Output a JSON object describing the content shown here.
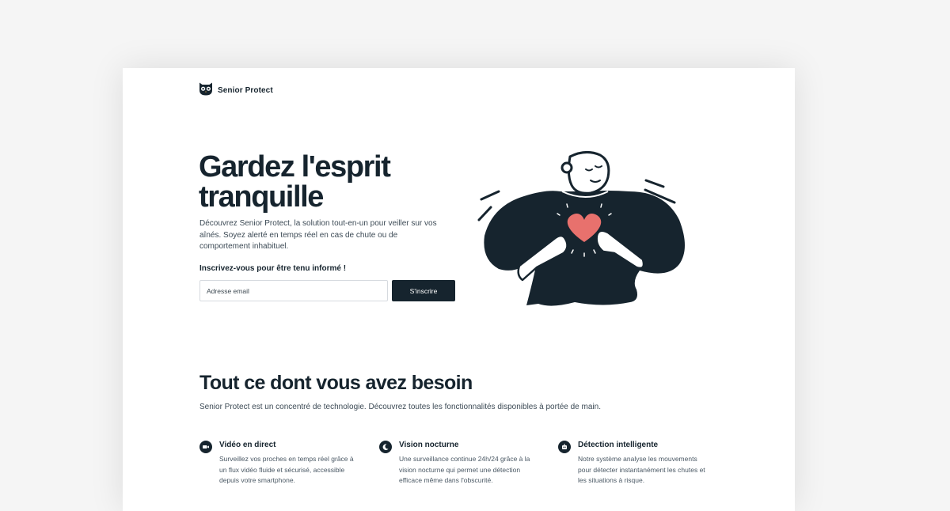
{
  "brand": {
    "name": "Senior Protect",
    "logo_icon": "owl-icon"
  },
  "hero": {
    "title": "Gardez l'esprit tranquille",
    "description": "Découvrez Senior Protect, la solution tout-en-un pour veiller sur vos aînés. Soyez alerté en temps réel en cas de chute ou de comportement inhabituel.",
    "signup_label": "Inscrivez-vous pour être tenu informé !",
    "email_placeholder": "Adresse email",
    "email_value": "",
    "button_label": "S'inscrire",
    "illustration_icon": "person-heart-illustration"
  },
  "features": {
    "title": "Tout ce dont vous avez besoin",
    "subtitle": "Senior Protect est un concentré de technologie. Découvrez toutes les fonctionnalités disponibles à portée de main.",
    "items": [
      {
        "title": "Vidéo en direct",
        "description": "Surveillez vos proches en temps réel grâce à un flux vidéo fluide et sécurisé, accessible depuis votre smartphone.",
        "icon": "video-camera-icon"
      },
      {
        "title": "Vision nocturne",
        "description": "Une surveillance continue 24h/24 grâce à la vision nocturne qui permet une détection efficace même dans l'obscurité.",
        "icon": "moon-icon"
      },
      {
        "title": "Détection intelligente",
        "description": "Notre système analyse les mouvements pour détecter instantanément les chutes et les situations à risque.",
        "icon": "robot-icon"
      }
    ]
  },
  "colors": {
    "primary": "#16242e",
    "heart": "#e8716d",
    "background": "#f5f5f5",
    "card": "#ffffff"
  }
}
